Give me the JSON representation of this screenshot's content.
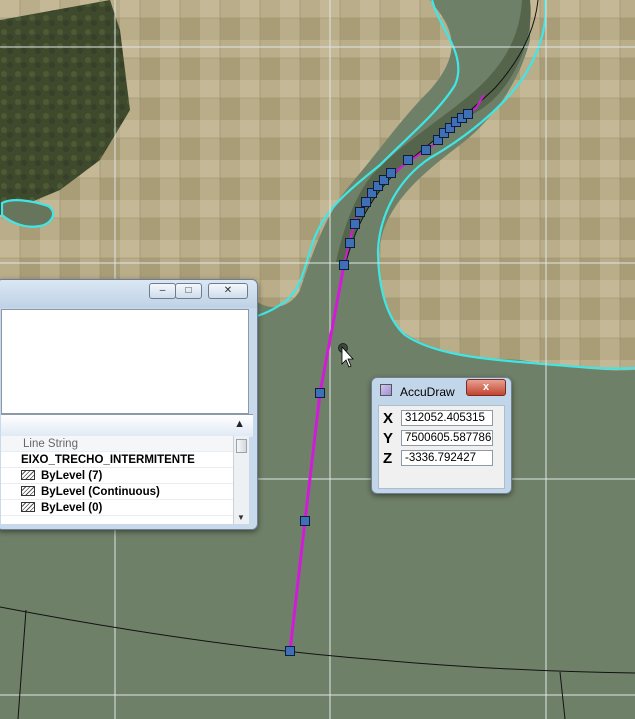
{
  "element_window": {
    "minimize_glyph": "–",
    "maximize_glyph": "□",
    "close_glyph": "✕",
    "collapse_glyph": "▲",
    "rows": [
      {
        "text": "Line String",
        "kind": "cat"
      },
      {
        "text": "EIXO_TRECHO_INTERMITENTE",
        "kind": "val"
      },
      {
        "text": "ByLevel (7)",
        "kind": "val",
        "icon": true
      },
      {
        "text": "ByLevel (Continuous)",
        "kind": "val",
        "icon": true
      },
      {
        "text": "ByLevel (0)",
        "kind": "val",
        "icon": true
      }
    ]
  },
  "accudraw": {
    "title": "AccuDraw",
    "close_glyph": "x",
    "x_label": "X",
    "x_value": "312052.405315",
    "y_label": "Y",
    "y_value": "7500605.587786",
    "z_label": "Z",
    "z_value": "-3336.792427"
  },
  "colors": {
    "water": "#6f8068",
    "river_outline": "#3fe6e6",
    "selected_line": "#d21bd8",
    "vertex_handle": "#3f6fb5",
    "grid": "#dfe6e6"
  }
}
